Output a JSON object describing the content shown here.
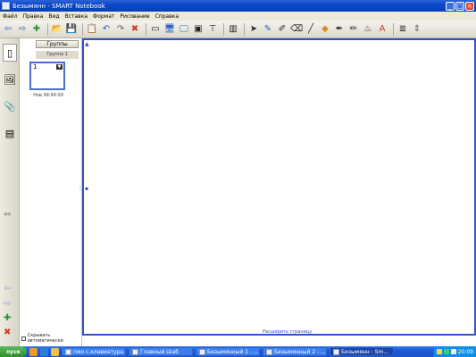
{
  "window": {
    "title": "Безымянн - SMART Notebook"
  },
  "menu": [
    "Файл",
    "Правка",
    "Вид",
    "Вставка",
    "Формат",
    "Рисование",
    "Справка"
  ],
  "toolbar": {
    "buttons": [
      {
        "name": "back-icon",
        "glyph": "⇦"
      },
      {
        "name": "forward-icon",
        "glyph": "⇨"
      },
      {
        "name": "add-page-icon",
        "glyph": "✚"
      },
      {
        "name": "open-icon",
        "glyph": "📂"
      },
      {
        "name": "save-icon",
        "glyph": "💾"
      },
      {
        "name": "paste-icon",
        "glyph": "📋"
      },
      {
        "name": "undo-icon",
        "glyph": "↶"
      },
      {
        "name": "redo-icon",
        "glyph": "↷"
      },
      {
        "name": "delete-icon",
        "glyph": "✖"
      },
      {
        "name": "screen-shade-icon",
        "glyph": "▭"
      },
      {
        "name": "full-screen-icon",
        "glyph": "🖥"
      },
      {
        "name": "dual-page-icon",
        "glyph": "🖵"
      },
      {
        "name": "screen-capture-icon",
        "glyph": "▣"
      },
      {
        "name": "doc-camera-icon",
        "glyph": "⊤"
      },
      {
        "name": "table-icon",
        "glyph": "▥"
      },
      {
        "name": "select-icon",
        "glyph": "➤"
      },
      {
        "name": "pen-icon",
        "glyph": "✎"
      },
      {
        "name": "creative-pen-icon",
        "glyph": "✐"
      },
      {
        "name": "eraser-icon",
        "glyph": "⌫"
      },
      {
        "name": "line-icon",
        "glyph": "╱"
      },
      {
        "name": "shapes-icon",
        "glyph": "◆"
      },
      {
        "name": "magic-pen-icon",
        "glyph": "✒"
      },
      {
        "name": "shape-recognition-pen-icon",
        "glyph": "✏"
      },
      {
        "name": "fill-icon",
        "glyph": "♨"
      },
      {
        "name": "text-icon",
        "glyph": "A"
      },
      {
        "name": "properties-icon",
        "glyph": "≣"
      },
      {
        "name": "move-toolbar-icon",
        "glyph": "⇕"
      }
    ]
  },
  "sidebar": {
    "tabs": [
      {
        "name": "page-sorter-tab",
        "glyph": "▯"
      },
      {
        "name": "gallery-tab",
        "glyph": "🖼"
      },
      {
        "name": "attachments-tab",
        "glyph": "📎"
      },
      {
        "name": "properties-tab",
        "glyph": "▤"
      }
    ]
  },
  "sorter": {
    "groups_button": "Группы",
    "group_label": "Группа 1",
    "page_number": "1",
    "page_caption": "Нов 99:99:99",
    "autohide_label": "Скрывать автоматически"
  },
  "page": {
    "extend_link": "Расширить страницу"
  },
  "taskbar": {
    "start_label": "пуск",
    "tasks": [
      {
        "label": "пмо с.клавиатура",
        "active": false
      },
      {
        "label": "Главный Шаб",
        "active": false
      },
      {
        "label": "Безымянный 1 - ...",
        "active": false
      },
      {
        "label": "Безымянный 2 - ...",
        "active": false
      },
      {
        "label": "Безымянн - Sm...",
        "active": true
      }
    ],
    "clock": "20:09"
  }
}
